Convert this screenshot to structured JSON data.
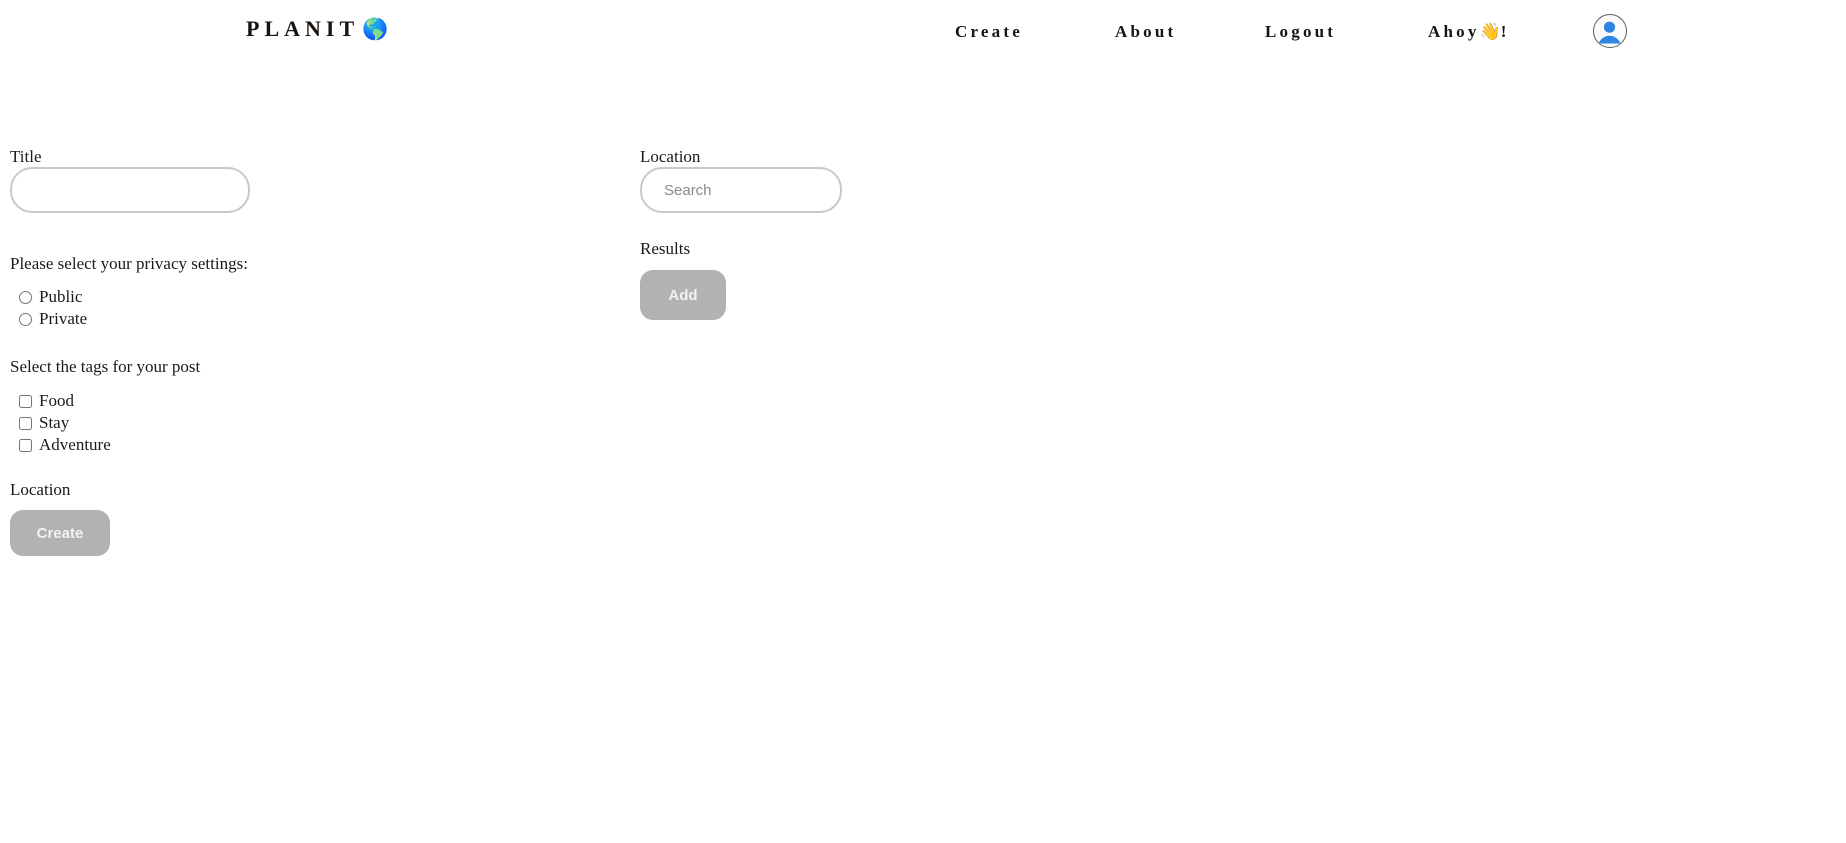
{
  "navbar": {
    "brand_text": "PLANIT",
    "brand_globe_icon": "globe-americas-emoji",
    "brand_globe_glyph": "🌎",
    "links": [
      {
        "label": "Create",
        "name": "nav-create"
      },
      {
        "label": "About",
        "name": "nav-about"
      },
      {
        "label": "Logout",
        "name": "nav-logout"
      }
    ],
    "greeting_prefix": "Ahoy",
    "greeting_wave_glyph": "👋",
    "greeting_suffix": "!",
    "avatar_icon": "user-avatar-icon",
    "avatar_colors": {
      "head": "#2f86e0",
      "body": "#2f86e0",
      "ring": "#5b5b5b",
      "bg": "#fbfbfb"
    }
  },
  "form": {
    "title": {
      "label": "Title",
      "value": "",
      "placeholder": ""
    },
    "privacy": {
      "label": "Please select your privacy settings:",
      "options": [
        {
          "label": "Public",
          "checked": false
        },
        {
          "label": "Private",
          "checked": false
        }
      ]
    },
    "tags": {
      "label": "Select the tags for your post",
      "options": [
        {
          "label": "Food",
          "checked": false
        },
        {
          "label": "Stay",
          "checked": false
        },
        {
          "label": "Adventure",
          "checked": false
        }
      ]
    },
    "location_selected": {
      "label": "Location"
    },
    "submit": {
      "label": "Create",
      "disabled": true,
      "bg_color": "#b2b2b2",
      "text_color": "#f2f2f2"
    }
  },
  "search_panel": {
    "location": {
      "label": "Location",
      "value": "",
      "placeholder": "Search"
    },
    "results": {
      "label": "Results"
    },
    "add": {
      "label": "Add",
      "disabled": true,
      "bg_color": "#b2b2b2",
      "text_color": "#f2f2f2"
    }
  },
  "theme": {
    "background": "#ffffff",
    "text": "#1a1a1a",
    "input_border": "#c9c9c9",
    "placeholder": "#8a8a8a"
  }
}
